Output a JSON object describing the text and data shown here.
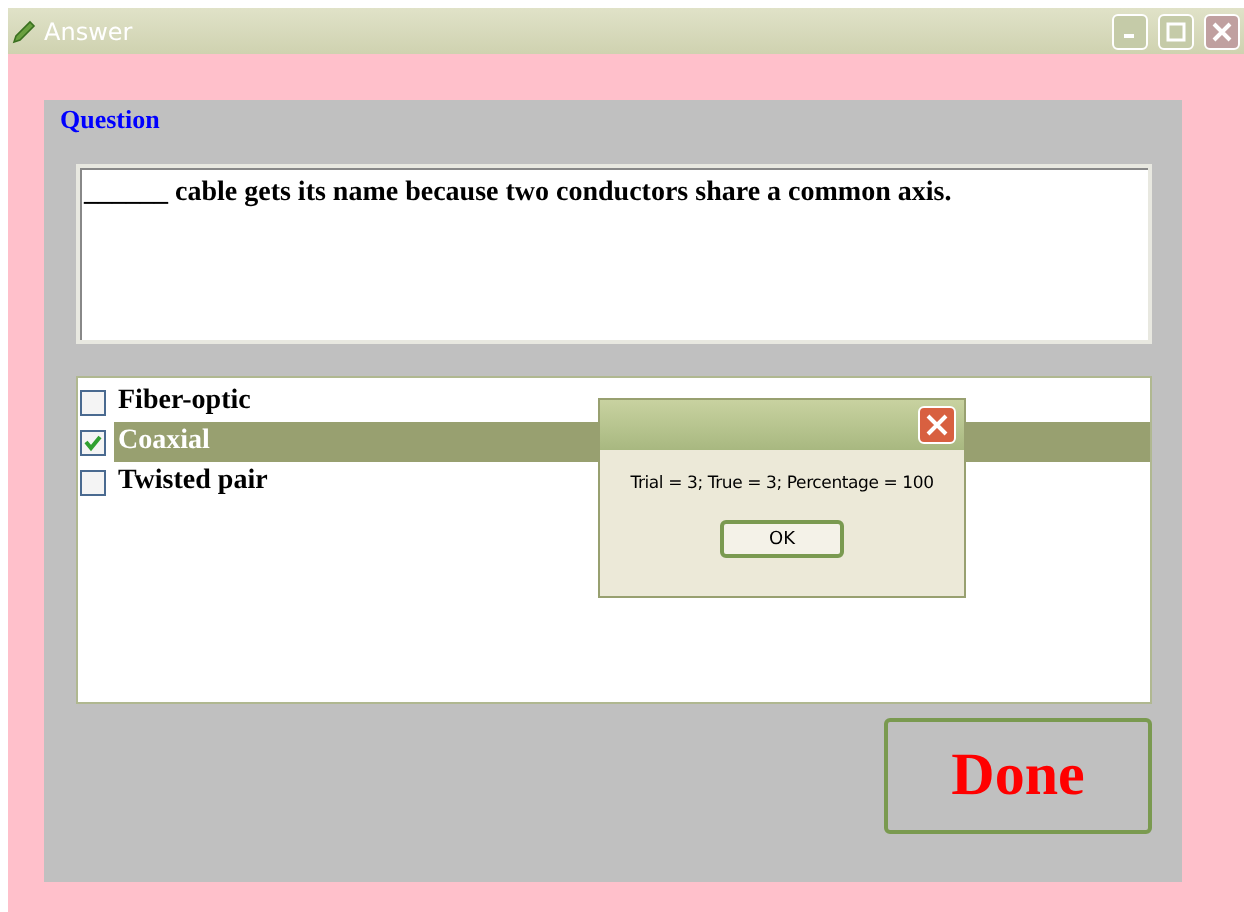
{
  "window": {
    "title": "Answer"
  },
  "question": {
    "legend": "Question",
    "text": "______ cable gets its name because two conductors share a common axis."
  },
  "choices": [
    {
      "label": "Fiber-optic",
      "checked": false,
      "selected": false
    },
    {
      "label": "Coaxial",
      "checked": true,
      "selected": true
    },
    {
      "label": "Twisted pair",
      "checked": false,
      "selected": false
    }
  ],
  "done_button": "Done",
  "dialog": {
    "message": "Trial = 3; True = 3; Percentage = 100",
    "button": "OK"
  }
}
